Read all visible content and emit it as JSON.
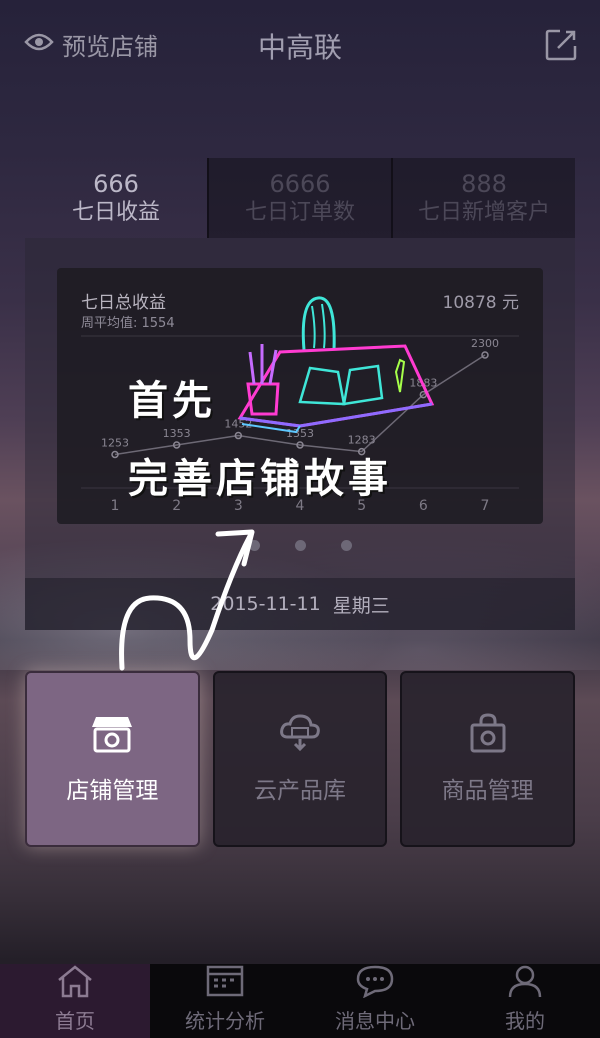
{
  "header": {
    "preview_label": "预览店铺",
    "title": "中高联"
  },
  "stats": [
    {
      "value": "666",
      "label": "七日收益"
    },
    {
      "value": "6666",
      "label": "七日订单数"
    },
    {
      "value": "888",
      "label": "七日新增客户"
    }
  ],
  "chart_card": {
    "title": "七日总收益",
    "subtitle": "周平均值: 1554",
    "total": "10878 元"
  },
  "chart_data": {
    "type": "line",
    "title": "七日总收益",
    "categories": [
      "1",
      "2",
      "3",
      "4",
      "5",
      "6",
      "7"
    ],
    "series": [
      {
        "values": [
          1253,
          1353,
          1452,
          1353,
          1283,
          1883,
          2300
        ]
      }
    ],
    "data_labels": [
      "1253",
      "1353",
      "1452",
      "1353",
      "1283",
      "1883",
      "2300"
    ],
    "ylim": [
      900,
      2500
    ],
    "grid": true
  },
  "date": {
    "date": "2015-11-11",
    "weekday": "星期三"
  },
  "tiles": [
    {
      "label": "店铺管理",
      "icon": "store-gear-icon"
    },
    {
      "label": "云产品库",
      "icon": "cloud-store-icon"
    },
    {
      "label": "商品管理",
      "icon": "bag-gear-icon"
    }
  ],
  "tabbar": [
    {
      "label": "首页",
      "icon": "home-icon"
    },
    {
      "label": "统计分析",
      "icon": "calendar-chart-icon"
    },
    {
      "label": "消息中心",
      "icon": "chat-bubble-icon"
    },
    {
      "label": "我的",
      "icon": "user-icon"
    }
  ],
  "tutorial": {
    "line1": "首先",
    "line2": "完善店铺故事"
  },
  "colors": {
    "accent_active_tile": "#7d6683",
    "tab_active_bg": "#2c1a30"
  }
}
